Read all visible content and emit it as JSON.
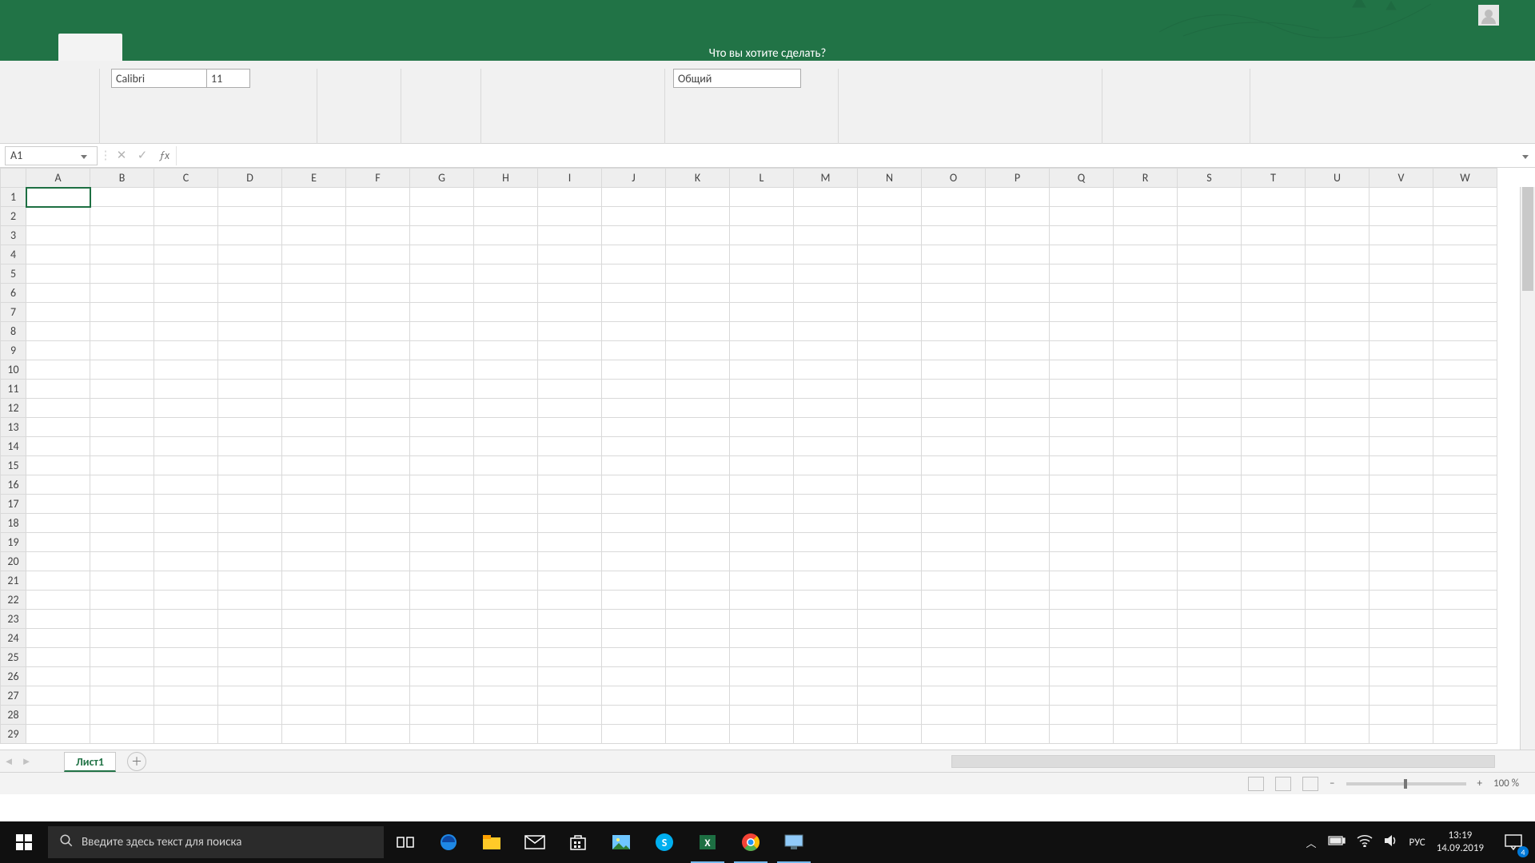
{
  "titlebar": {
    "tell_me": "Что вы хотите сделать?"
  },
  "ribbon": {
    "font_name": "Calibri",
    "font_size": "11",
    "number_format": "Общий"
  },
  "formula_bar": {
    "name_box": "A1",
    "formula": ""
  },
  "grid": {
    "columns": [
      "A",
      "B",
      "C",
      "D",
      "E",
      "F",
      "G",
      "H",
      "I",
      "J",
      "K",
      "L",
      "M",
      "N",
      "O",
      "P",
      "Q",
      "R",
      "S",
      "T",
      "U",
      "V",
      "W"
    ],
    "rows": [
      "1",
      "2",
      "3",
      "4",
      "5",
      "6",
      "7",
      "8",
      "9",
      "10",
      "11",
      "12",
      "13",
      "14",
      "15",
      "16",
      "17",
      "18",
      "19",
      "20",
      "21",
      "22",
      "23",
      "24",
      "25",
      "26",
      "27",
      "28",
      "29"
    ],
    "active_cell": "A1"
  },
  "sheet_tabs": {
    "active": "Лист1"
  },
  "statusbar": {
    "zoom": "100 %"
  },
  "taskbar": {
    "search_placeholder": "Введите здесь текст для поиска",
    "lang": "РУС",
    "time": "13:19",
    "date": "14.09.2019",
    "action_center_badge": "4"
  }
}
